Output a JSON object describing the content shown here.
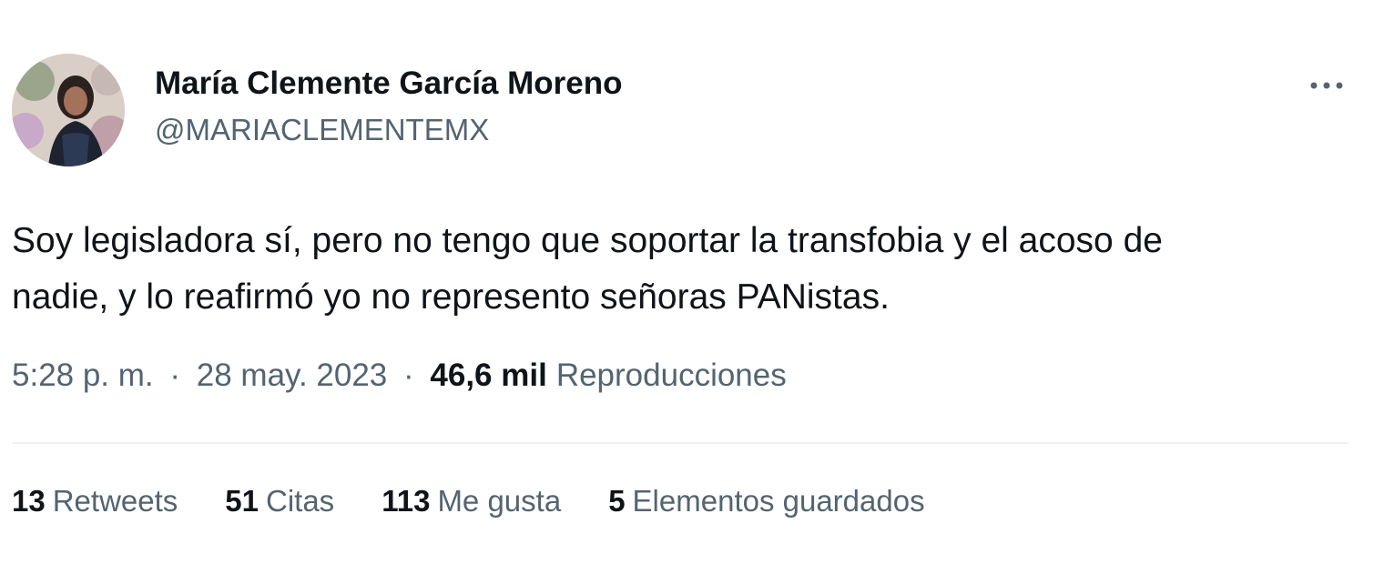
{
  "author": {
    "name": "María Clemente García Moreno",
    "handle": "@MARIACLEMENTEMX"
  },
  "tweet": {
    "lines": [
      "Soy legisladora sí, pero no tengo que soportar la transfobia y el acoso de",
      "nadie, y lo reafirmó yo no represento señoras PANistas."
    ]
  },
  "meta": {
    "time": "5:28 p. m.",
    "separator": "·",
    "date": "28 may. 2023",
    "views_count": "46,6 mil",
    "views_label": "Reproducciones"
  },
  "stats": [
    {
      "count": "13",
      "label": "Retweets"
    },
    {
      "count": "51",
      "label": "Citas"
    },
    {
      "count": "113",
      "label": "Me gusta"
    },
    {
      "count": "5",
      "label": "Elementos guardados"
    }
  ],
  "icons": {
    "more": "more-horizontal-icon"
  },
  "colors": {
    "primary_text": "#0f1419",
    "secondary_text": "#536471",
    "divider": "#eff3f4"
  }
}
